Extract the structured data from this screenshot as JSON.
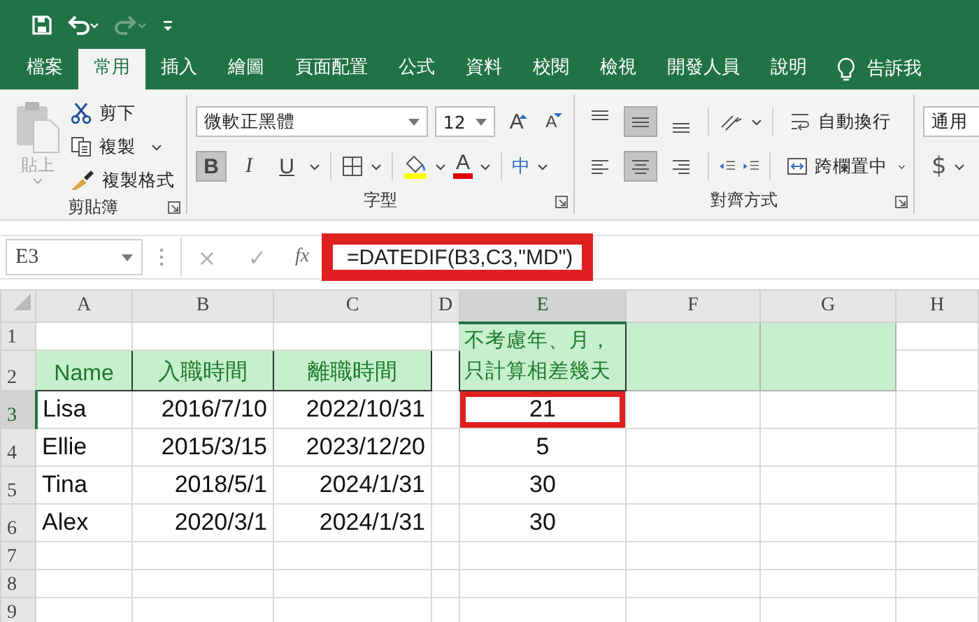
{
  "quick_access": {
    "undo_disabled": false,
    "redo_disabled": true
  },
  "tabs": [
    {
      "label": "檔案",
      "selected": false
    },
    {
      "label": "常用",
      "selected": true
    },
    {
      "label": "插入",
      "selected": false
    },
    {
      "label": "繪圖",
      "selected": false
    },
    {
      "label": "頁面配置",
      "selected": false
    },
    {
      "label": "公式",
      "selected": false
    },
    {
      "label": "資料",
      "selected": false
    },
    {
      "label": "校閱",
      "selected": false
    },
    {
      "label": "檢視",
      "selected": false
    },
    {
      "label": "開發人員",
      "selected": false
    },
    {
      "label": "說明",
      "selected": false
    }
  ],
  "tell_me": {
    "label": "告訴我"
  },
  "ribbon": {
    "clipboard": {
      "label": "剪貼簿",
      "paste": {
        "label": "貼上",
        "disabled": true
      },
      "commands": [
        {
          "label": "剪下",
          "kind": "cut",
          "caret": false
        },
        {
          "label": "複製",
          "kind": "copy",
          "caret": true
        },
        {
          "label": "複製格式",
          "kind": "brush",
          "caret": false
        }
      ]
    },
    "font": {
      "label": "字型",
      "font_name": "微軟正黑體",
      "font_size": "12",
      "size_buttons": [
        {
          "label": "A",
          "kind": "grow"
        },
        {
          "label": "A",
          "kind": "shrink"
        }
      ],
      "format_buttons": [
        {
          "label": "B",
          "kind": "bold",
          "selected": true
        },
        {
          "label": "I",
          "kind": "italic",
          "selected": false
        },
        {
          "label": "U",
          "kind": "underline",
          "selected": false
        }
      ],
      "border_button": {
        "caret": true
      },
      "fill_button": {
        "color": "#ffff00"
      },
      "font_color_button": {
        "label": "A",
        "color": "#e00000"
      },
      "phonetic_button": {
        "label": "中"
      }
    },
    "alignment": {
      "label": "對齊方式",
      "vertical": [
        {
          "kind": "top",
          "selected": false
        },
        {
          "kind": "middle",
          "selected": true
        },
        {
          "kind": "bottom",
          "selected": false
        }
      ],
      "horizontal": [
        {
          "kind": "left",
          "selected": false
        },
        {
          "kind": "center",
          "selected": true
        },
        {
          "kind": "right",
          "selected": false
        }
      ],
      "wrap": {
        "label": "自動換行"
      },
      "merge": {
        "label": "跨欄置中"
      }
    },
    "number": {
      "format": "通用",
      "currency": "$"
    }
  },
  "formula_bar": {
    "name_box": "E3",
    "cancel": "×",
    "enter": "✓",
    "fx": "fx",
    "formula": "=DATEDIF(B3,C3,\"MD\")",
    "highlighted": true
  },
  "sheet": {
    "columns": [
      {
        "label": "A",
        "selected": false
      },
      {
        "label": "B",
        "selected": false
      },
      {
        "label": "C",
        "selected": false
      },
      {
        "label": "D",
        "selected": false
      },
      {
        "label": "E",
        "selected": true
      },
      {
        "label": "F",
        "selected": false
      },
      {
        "label": "G",
        "selected": false
      },
      {
        "label": "H",
        "selected": false
      }
    ],
    "top_rows": [
      {
        "label": "1",
        "selected": false
      },
      {
        "label": "2",
        "selected": false
      }
    ],
    "header_cells": [
      {
        "kind": "header",
        "text": "Name"
      },
      {
        "kind": "header",
        "text": "入職時間"
      },
      {
        "kind": "header",
        "text": "離職時間"
      },
      {
        "kind": "empty"
      },
      {
        "kind": "merged",
        "text": "不考慮年、月，只計算相差幾天"
      },
      {
        "kind": "fill"
      },
      {
        "kind": "fill"
      },
      {
        "kind": "empty"
      }
    ],
    "rows": [
      {
        "label": "3",
        "selected": true,
        "cells": [
          {
            "kind": "text",
            "text": "Lisa",
            "highlighted": false
          },
          {
            "kind": "date",
            "text": "2016/7/10",
            "highlighted": false
          },
          {
            "kind": "date",
            "text": "2022/10/31",
            "highlighted": false
          },
          {
            "kind": "empty",
            "highlighted": false
          },
          {
            "kind": "count",
            "text": "21",
            "highlighted": true
          },
          {
            "kind": "empty",
            "highlighted": false
          },
          {
            "kind": "empty",
            "highlighted": false
          },
          {
            "kind": "empty",
            "highlighted": false
          }
        ]
      },
      {
        "label": "4",
        "selected": false,
        "cells": [
          {
            "kind": "text",
            "text": "Ellie",
            "highlighted": false
          },
          {
            "kind": "date",
            "text": "2015/3/15",
            "highlighted": false
          },
          {
            "kind": "date",
            "text": "2023/12/20",
            "highlighted": false
          },
          {
            "kind": "empty",
            "highlighted": false
          },
          {
            "kind": "count",
            "text": "5",
            "highlighted": false
          },
          {
            "kind": "empty",
            "highlighted": false
          },
          {
            "kind": "empty",
            "highlighted": false
          },
          {
            "kind": "empty",
            "highlighted": false
          }
        ]
      },
      {
        "label": "5",
        "selected": false,
        "cells": [
          {
            "kind": "text",
            "text": "Tina",
            "highlighted": false
          },
          {
            "kind": "date",
            "text": "2018/5/1",
            "highlighted": false
          },
          {
            "kind": "date",
            "text": "2024/1/31",
            "highlighted": false
          },
          {
            "kind": "empty",
            "highlighted": false
          },
          {
            "kind": "count",
            "text": "30",
            "highlighted": false
          },
          {
            "kind": "empty",
            "highlighted": false
          },
          {
            "kind": "empty",
            "highlighted": false
          },
          {
            "kind": "empty",
            "highlighted": false
          }
        ]
      },
      {
        "label": "6",
        "selected": false,
        "cells": [
          {
            "kind": "text",
            "text": "Alex",
            "highlighted": false
          },
          {
            "kind": "date",
            "text": "2020/3/1",
            "highlighted": false
          },
          {
            "kind": "date",
            "text": "2024/1/31",
            "highlighted": false
          },
          {
            "kind": "empty",
            "highlighted": false
          },
          {
            "kind": "count",
            "text": "30",
            "highlighted": false
          },
          {
            "kind": "empty",
            "highlighted": false
          },
          {
            "kind": "empty",
            "highlighted": false
          },
          {
            "kind": "empty",
            "highlighted": false
          }
        ]
      }
    ],
    "empty_rows": [
      {
        "label": "7",
        "selected": false
      },
      {
        "label": "8",
        "selected": false
      },
      {
        "label": "9",
        "selected": false
      }
    ]
  }
}
